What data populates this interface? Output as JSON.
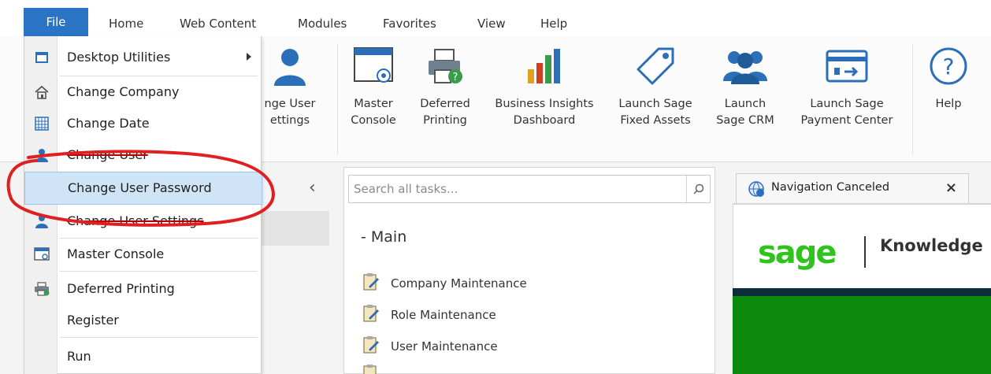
{
  "menubar": {
    "file": "File",
    "tabs": [
      "Home",
      "Web Content",
      "Modules",
      "Favorites",
      "View",
      "Help"
    ]
  },
  "ribbon": {
    "buttons": [
      {
        "label": "nge User\nettings",
        "icon": "user-icon"
      },
      {
        "label": "Master\nConsole",
        "icon": "master-console-icon"
      },
      {
        "label": "Deferred\nPrinting",
        "icon": "printer-icon"
      },
      {
        "label": "Business Insights\nDashboard",
        "icon": "bar-chart-icon"
      },
      {
        "label": "Launch Sage\nFixed Assets",
        "icon": "tag-icon"
      },
      {
        "label": "Launch\nSage CRM",
        "icon": "users-icon"
      },
      {
        "label": "Launch Sage\nPayment Center",
        "icon": "payment-card-icon"
      },
      {
        "label": "Help",
        "icon": "help-icon"
      }
    ]
  },
  "file_menu": {
    "items": [
      {
        "label": "Desktop Utilities",
        "icon": "desktop-icon",
        "submenu": true
      },
      {
        "label": "Change Company",
        "icon": "home-icon"
      },
      {
        "label": "Change Date",
        "icon": "calendar-icon"
      },
      {
        "label": "Change User",
        "icon": "user-icon"
      },
      {
        "label": "Change User Password",
        "icon": "",
        "selected": true
      },
      {
        "label": "Change User Settings",
        "icon": "user-settings-icon"
      },
      {
        "label": "Master Console",
        "icon": "master-console-icon"
      },
      {
        "label": "Deferred Printing",
        "icon": "printer-icon"
      },
      {
        "label": "Register",
        "icon": ""
      },
      {
        "label": "Run",
        "icon": ""
      }
    ]
  },
  "tasks": {
    "search_placeholder": "Search all tasks...",
    "group": "- Main",
    "items": [
      "Company Maintenance",
      "Role Maintenance",
      "User Maintenance"
    ]
  },
  "browser": {
    "tab_title": "Navigation Canceled",
    "close": "×",
    "logo": "sage",
    "kb_text": "Knowledge",
    "colors": {
      "logo": "#2ec41d",
      "band_dark": "#0b2f3a",
      "band_green": "#0c8a0c"
    }
  },
  "colors": {
    "file_tab": "#2b73c5",
    "selected_item": "#cfe4f7",
    "annotation": "#e02020"
  }
}
